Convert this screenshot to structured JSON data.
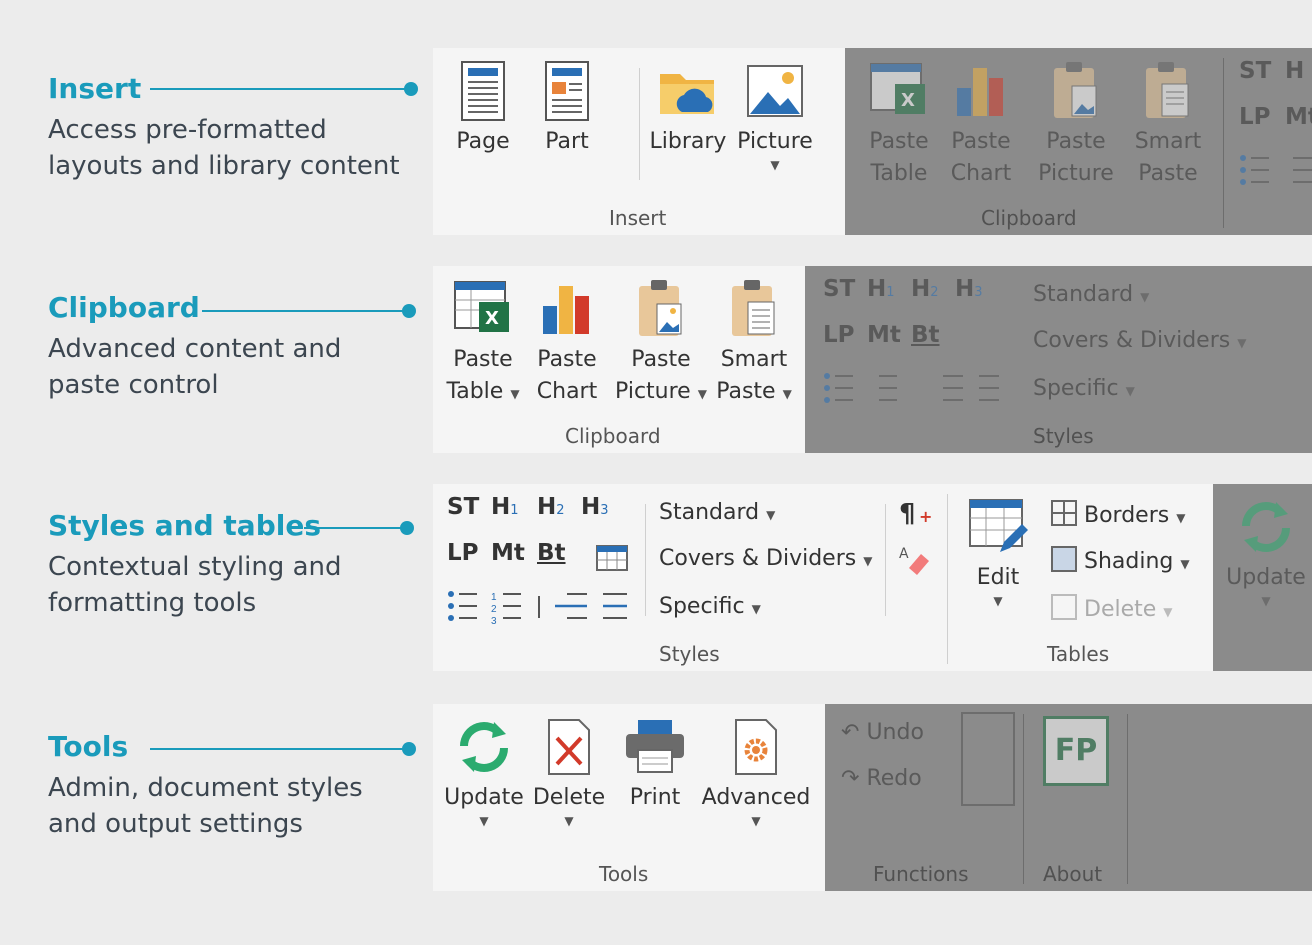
{
  "callouts": {
    "insert": {
      "title": "Insert",
      "desc_line1": "Access pre-formatted",
      "desc_line2": "layouts and library content"
    },
    "clipboard": {
      "title": "Clipboard",
      "desc_line1": "Advanced content and",
      "desc_line2": "paste control"
    },
    "styles": {
      "title": "Styles and tables",
      "desc_line1": "Contextual styling and",
      "desc_line2": "formatting tools"
    },
    "tools": {
      "title": "Tools",
      "desc_line1": "Admin, document styles",
      "desc_line2": "and output settings"
    }
  },
  "insert_ribbon": {
    "page": "Page",
    "part": "Part",
    "library": "Library",
    "picture": "Picture",
    "group": "Insert",
    "paste_table_1": "Paste",
    "paste_table_2": "Table",
    "paste_chart_1": "Paste",
    "paste_chart_2": "Chart",
    "paste_picture_1": "Paste",
    "paste_picture_2": "Picture",
    "smart_paste_1": "Smart",
    "smart_paste_2": "Paste",
    "clipboard_group": "Clipboard",
    "st": "ST",
    "h": "H",
    "lp": "LP",
    "mt": "Mt"
  },
  "clipboard_ribbon": {
    "paste_table_1": "Paste",
    "paste_table_2": "Table",
    "paste_chart_1": "Paste",
    "paste_chart_2": "Chart",
    "paste_picture_1": "Paste",
    "paste_picture_2": "Picture",
    "smart_paste_1": "Smart",
    "smart_paste_2": "Paste",
    "group": "Clipboard",
    "st": "ST",
    "h": "H",
    "s1": "1",
    "s2": "2",
    "s3": "3",
    "lp": "LP",
    "mt": "Mt",
    "bt": "Bt",
    "standard": "Standard",
    "covers": "Covers & Dividers",
    "specific": "Specific",
    "styles_group": "Styles"
  },
  "styles_ribbon": {
    "st": "ST",
    "h": "H",
    "s1": "1",
    "s2": "2",
    "s3": "3",
    "lp": "LP",
    "mt": "Mt",
    "bt": "Bt",
    "standard": "Standard",
    "covers": "Covers & Dividers",
    "specific": "Specific",
    "group": "Styles",
    "edit": "Edit",
    "borders": "Borders",
    "shading": "Shading",
    "delete": "Delete",
    "tables_group": "Tables",
    "update": "Update"
  },
  "tools_ribbon": {
    "update": "Update",
    "delete": "Delete",
    "print": "Print",
    "advanced": "Advanced",
    "group": "Tools",
    "undo": "Undo",
    "redo": "Redo",
    "functions_group": "Functions",
    "about_group": "About",
    "fp": "FP"
  },
  "colors": {
    "accent": "#1a9bbb",
    "text": "#3c4650",
    "excel_green": "#217346",
    "update_green": "#2bab6f",
    "delete_red": "#d23a2a"
  }
}
